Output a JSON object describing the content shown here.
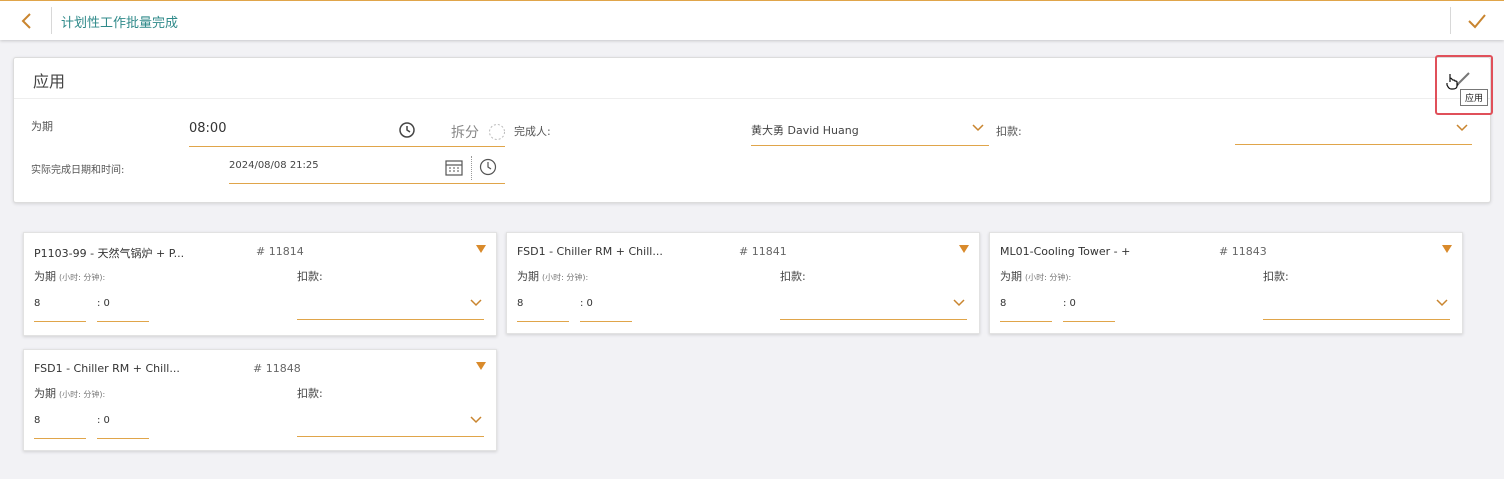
{
  "header": {
    "title": "计划性工作批量完成",
    "back_icon": "chevron-left-icon",
    "confirm_icon": "check-icon"
  },
  "panel": {
    "title": "应用",
    "duration_label": "为期",
    "duration_value": "08:00",
    "split_label": "拆分",
    "completer_label": "完成人:",
    "completer_value": "黄大勇 David Huang",
    "deduction_label": "扣款:",
    "deduction_value": "",
    "actual_label": "实际完成日期和时间:",
    "actual_value": "2024/08/08 21:25",
    "apply_tooltip": "应用"
  },
  "cards": [
    {
      "title": "P1103-99 - 天然气锅炉 + P...",
      "number": "# 11814",
      "duration_label": "为期",
      "duration_hint": "(小时: 分钟):",
      "hours": "8",
      "minutes": ": 0",
      "deduction_label": "扣款:"
    },
    {
      "title": "FSD1 - Chiller RM + Chill...",
      "number": "# 11841",
      "duration_label": "为期",
      "duration_hint": "(小时: 分钟):",
      "hours": "8",
      "minutes": ": 0",
      "deduction_label": "扣款:"
    },
    {
      "title": "ML01-Cooling Tower - +",
      "number": "# 11843",
      "duration_label": "为期",
      "duration_hint": "(小时: 分钟):",
      "hours": "8",
      "minutes": ": 0",
      "deduction_label": "扣款:"
    },
    {
      "title": "FSD1 - Chiller RM + Chill...",
      "number": "# 11848",
      "duration_label": "为期",
      "duration_hint": "(小时: 分钟):",
      "hours": "8",
      "minutes": ": 0",
      "deduction_label": "扣款:"
    }
  ],
  "colors": {
    "accent": "#e0a54a",
    "title": "#2f8a8a",
    "highlight": "#e0505a",
    "triangle": "#d98a2b"
  }
}
